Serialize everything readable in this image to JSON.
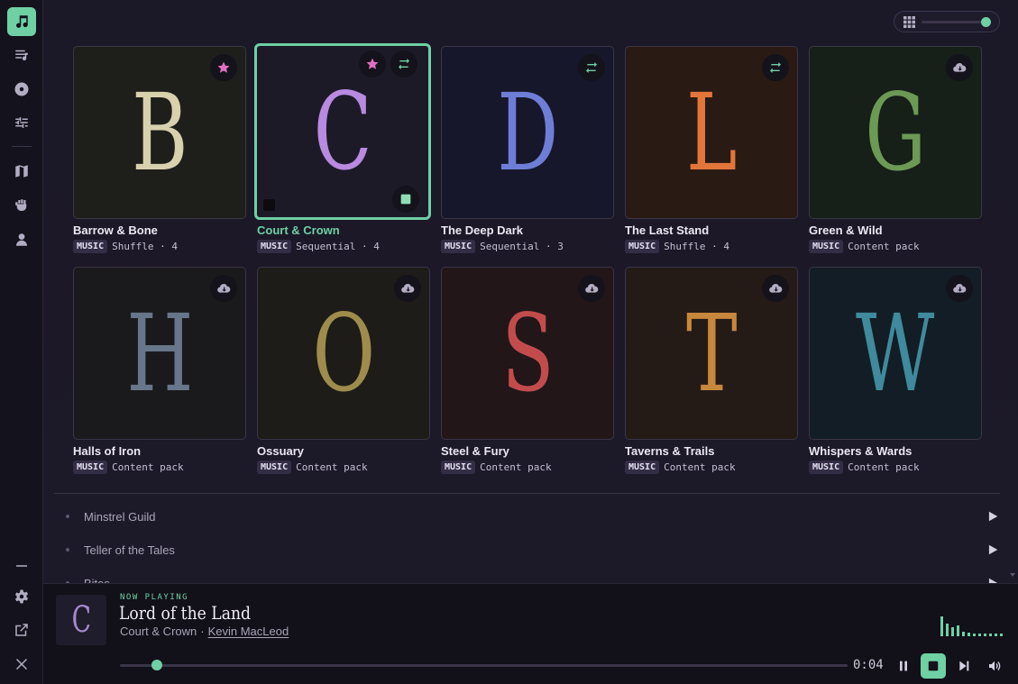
{
  "sidebar": {
    "top": [
      "music-icon",
      "playlist-icon",
      "disc-icon",
      "sliders-icon"
    ],
    "middle": [
      "map-icon",
      "fist-icon",
      "user-icon"
    ],
    "bottom": [
      "collapse-icon",
      "settings-icon",
      "external-link-icon",
      "close-icon"
    ]
  },
  "zoom": {
    "level": 0.9
  },
  "cards": [
    {
      "letter": "B",
      "title": "Barrow & Bone",
      "tag": "MUSIC",
      "meta": "Shuffle · 4",
      "letter_color": "#d8d1ae",
      "bg": "#1e1e1a",
      "badges": [
        "star-icon"
      ]
    },
    {
      "letter": "C",
      "title": "Court & Crown",
      "tag": "MUSIC",
      "meta": "Sequential · 4",
      "letter_color": "#b88ae0",
      "bg": "#1d1a28",
      "badges": [
        "star-icon",
        "repeat-icon"
      ],
      "selected": true
    },
    {
      "letter": "D",
      "title": "The Deep Dark",
      "tag": "MUSIC",
      "meta": "Sequential · 3",
      "letter_color": "#6e7ed6",
      "bg": "#16172a",
      "badges": [
        "repeat-icon"
      ]
    },
    {
      "letter": "L",
      "title": "The Last Stand",
      "tag": "MUSIC",
      "meta": "Shuffle · 4",
      "letter_color": "#e2763a",
      "bg": "#2a1a14",
      "badges": [
        "repeat-icon"
      ]
    },
    {
      "letter": "G",
      "title": "Green & Wild",
      "tag": "MUSIC",
      "meta": "Content pack",
      "letter_color": "#6c9a55",
      "bg": "#161f18",
      "badges": [
        "cloud-download-icon"
      ]
    },
    {
      "letter": "H",
      "title": "Halls of Iron",
      "tag": "MUSIC",
      "meta": "Content pack",
      "letter_color": "#67768a",
      "bg": "#1a1a1d",
      "badges": [
        "cloud-download-icon"
      ]
    },
    {
      "letter": "O",
      "title": "Ossuary",
      "tag": "MUSIC",
      "meta": "Content pack",
      "letter_color": "#9e8c4c",
      "bg": "#1d1c18",
      "badges": [
        "cloud-download-icon"
      ]
    },
    {
      "letter": "S",
      "title": "Steel & Fury",
      "tag": "MUSIC",
      "meta": "Content pack",
      "letter_color": "#c24c4c",
      "bg": "#221619",
      "badges": [
        "cloud-download-icon"
      ]
    },
    {
      "letter": "T",
      "title": "Taverns & Trails",
      "tag": "MUSIC",
      "meta": "Content pack",
      "letter_color": "#c7873c",
      "bg": "#241b17",
      "badges": [
        "cloud-download-icon"
      ]
    },
    {
      "letter": "W",
      "title": "Whispers & Wards",
      "tag": "MUSIC",
      "meta": "Content pack",
      "letter_color": "#3f8a9c",
      "bg": "#131d25",
      "badges": [
        "cloud-download-icon"
      ]
    }
  ],
  "playlists": [
    "Minstrel Guild",
    "Teller of the Tales",
    "Bites"
  ],
  "player": {
    "label": "NOW PLAYING",
    "art_letter": "C",
    "title": "Lord of the Land",
    "album": "Court & Crown",
    "separator": "·",
    "artist": "Kevin MacLeod",
    "time": "0:04",
    "progress": 0.03
  },
  "colors": {
    "accent": "#6fd0a4",
    "star": "#e06fc2"
  }
}
